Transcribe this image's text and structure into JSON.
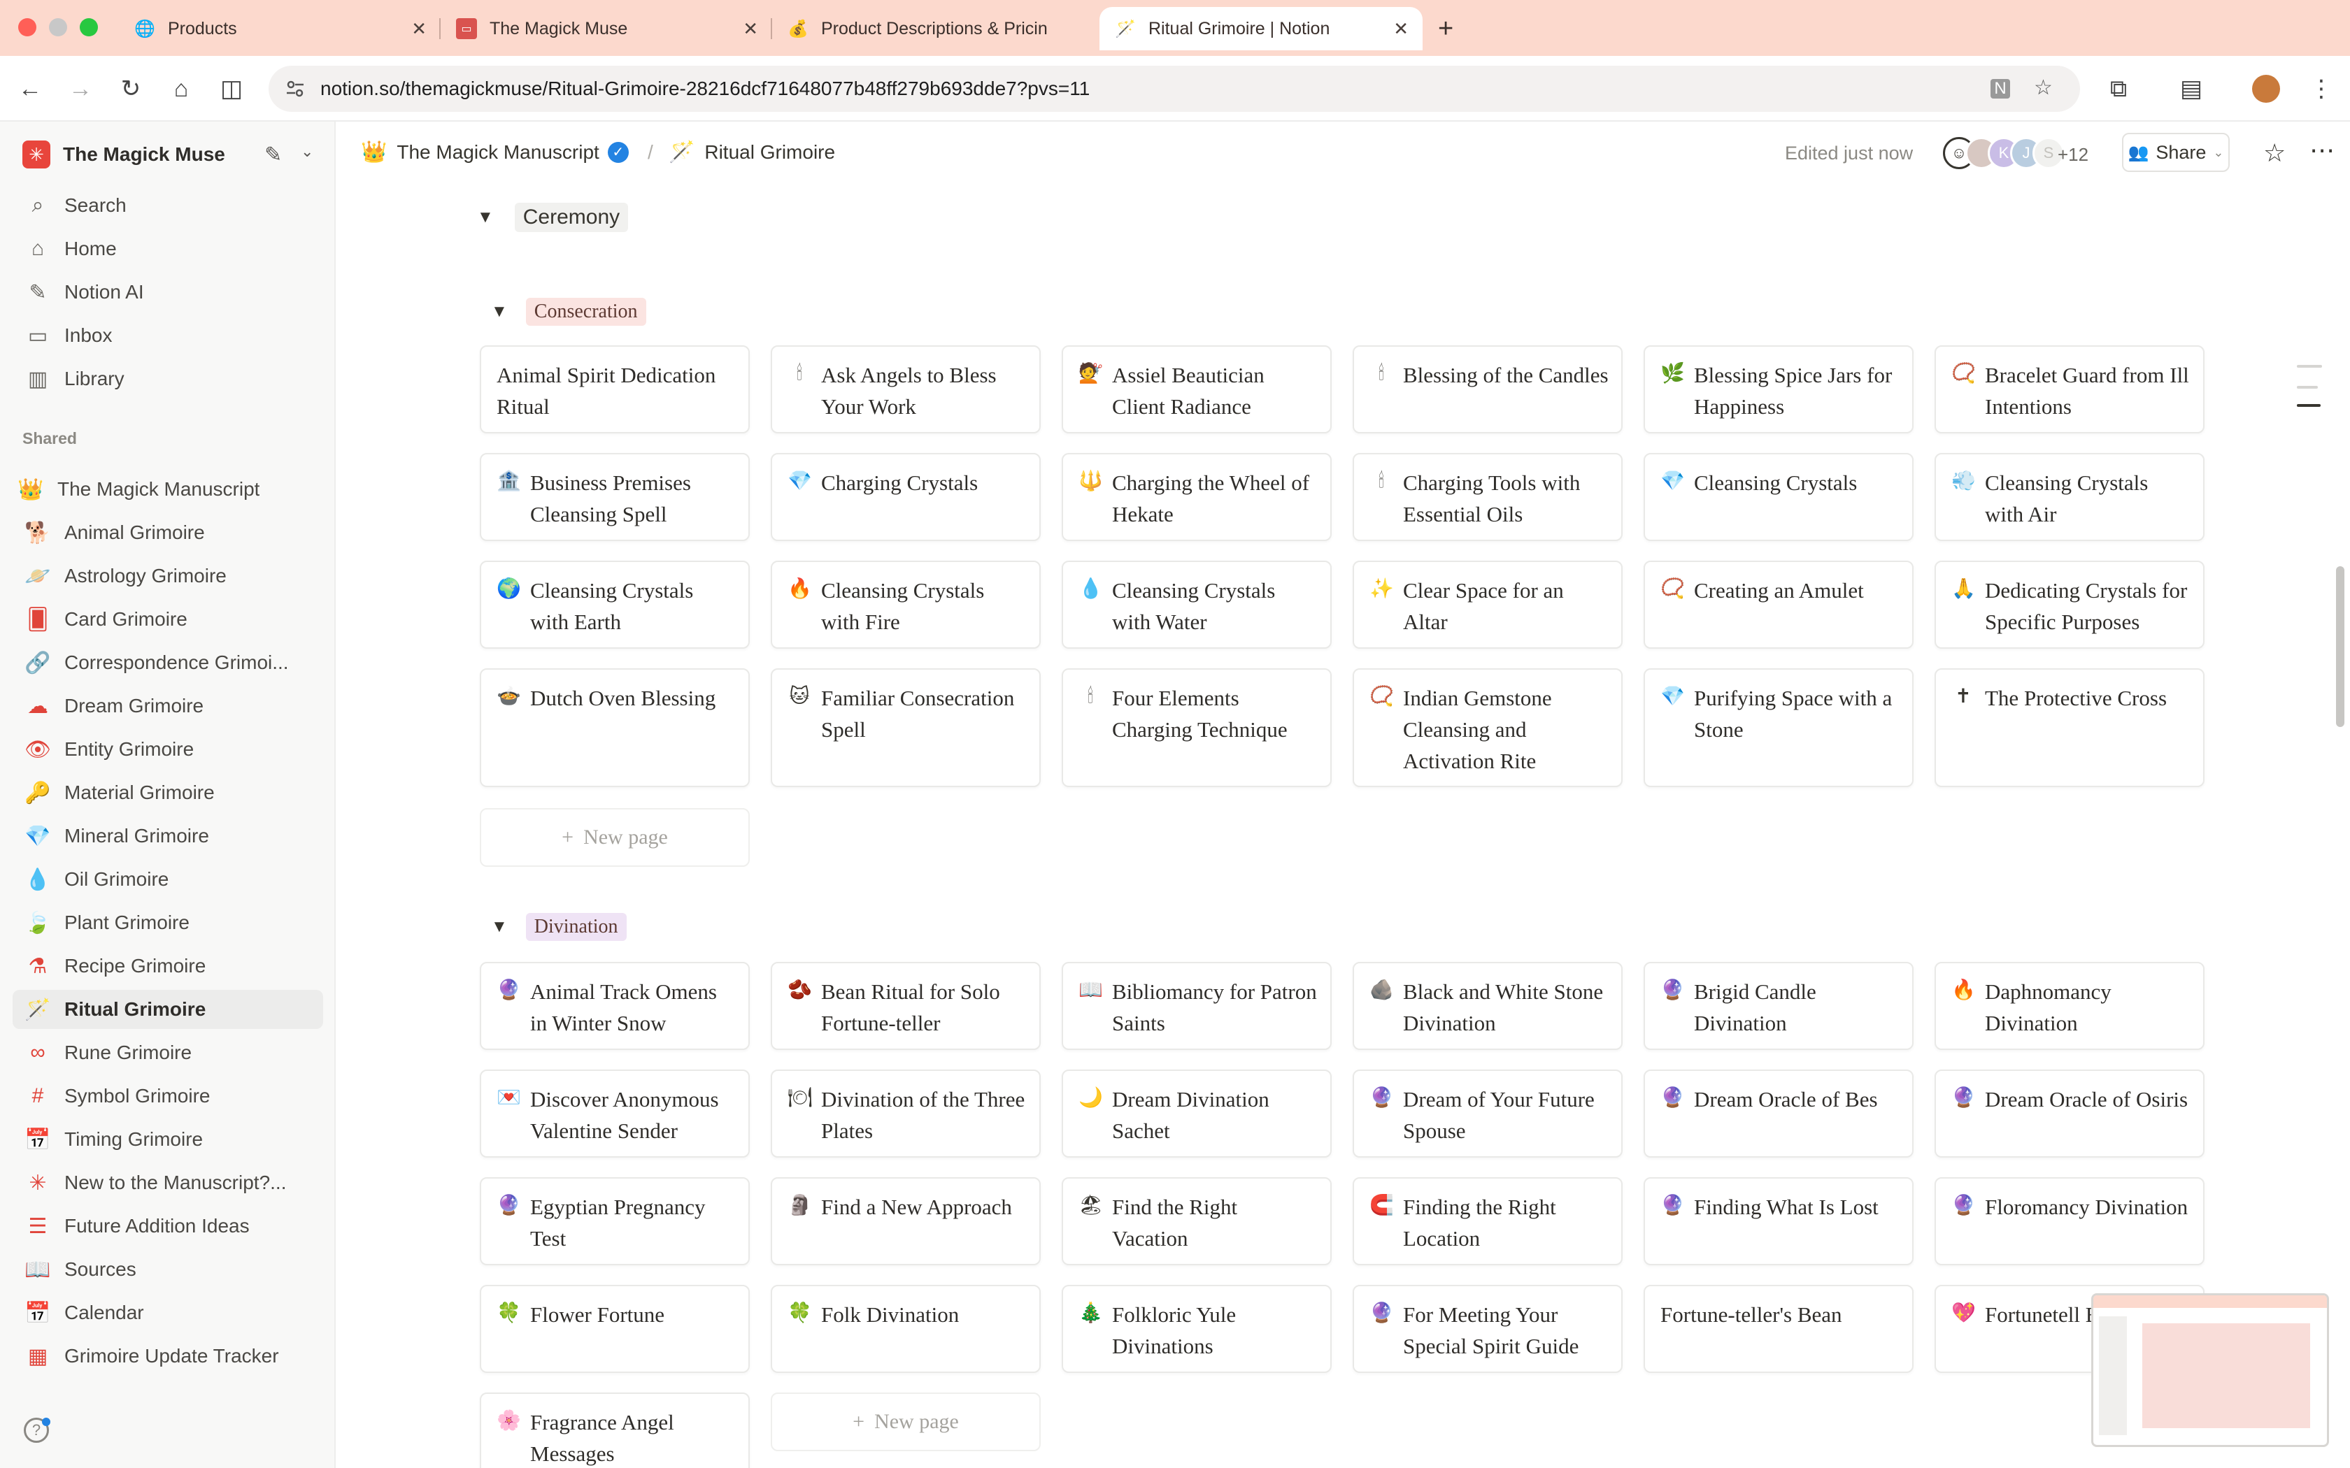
{
  "browser": {
    "tabs": [
      {
        "label": "Products",
        "icon": "globe-icon",
        "glyph": "🌐"
      },
      {
        "label": "The Magick Muse",
        "icon": "shop-icon",
        "glyph": "🟥"
      },
      {
        "label": "Product Descriptions & Pricin",
        "icon": "money-bag-icon",
        "glyph": "💰"
      },
      {
        "label": "Ritual Grimoire | Notion",
        "icon": "magic-wand-icon",
        "glyph": "🪄"
      }
    ],
    "url": "notion.so/themagickmuse/Ritual-Grimoire-28216dcf71648077b48ff279b693dde7?pvs=11",
    "colors": {
      "tabbar": "#fcd9cd",
      "active_tab": "#ffffff"
    }
  },
  "sidebar": {
    "workspace_name": "The Magick Muse",
    "top_items": [
      {
        "label": "Search",
        "icon": "search-icon",
        "glyph": "⌕"
      },
      {
        "label": "Home",
        "icon": "home-icon",
        "glyph": "⌂"
      },
      {
        "label": "Notion AI",
        "icon": "ai-icon",
        "glyph": "✎"
      },
      {
        "label": "Inbox",
        "icon": "inbox-icon",
        "glyph": "▭"
      },
      {
        "label": "Library",
        "icon": "library-icon",
        "glyph": "▥"
      }
    ],
    "shared_heading": "Shared",
    "shared_items": [
      {
        "label": "The Magick Manuscript",
        "icon": "crown-icon",
        "glyph": "👑"
      },
      {
        "label": "Animal Grimoire",
        "icon": "dog-icon",
        "glyph": "🐕"
      },
      {
        "label": "Astrology Grimoire",
        "icon": "planet-icon",
        "glyph": "🪐"
      },
      {
        "label": "Card Grimoire",
        "icon": "cards-icon",
        "glyph": "🂠"
      },
      {
        "label": "Correspondence Grimoi...",
        "icon": "link-icon",
        "glyph": "🔗"
      },
      {
        "label": "Dream Grimoire",
        "icon": "cloud-icon",
        "glyph": "☁"
      },
      {
        "label": "Entity Grimoire",
        "icon": "eye-icon",
        "glyph": "👁"
      },
      {
        "label": "Material Grimoire",
        "icon": "key-icon",
        "glyph": "🔑"
      },
      {
        "label": "Mineral Grimoire",
        "icon": "gem-icon",
        "glyph": "💎"
      },
      {
        "label": "Oil Grimoire",
        "icon": "drop-icon",
        "glyph": "💧"
      },
      {
        "label": "Plant Grimoire",
        "icon": "leaf-icon",
        "glyph": "🍃"
      },
      {
        "label": "Recipe Grimoire",
        "icon": "flask-icon",
        "glyph": "⚗"
      },
      {
        "label": "Ritual Grimoire",
        "icon": "magic-wand-icon",
        "glyph": "🪄"
      },
      {
        "label": "Rune Grimoire",
        "icon": "infinity-icon",
        "glyph": "∞"
      },
      {
        "label": "Symbol Grimoire",
        "icon": "hash-icon",
        "glyph": "#"
      },
      {
        "label": "Timing Grimoire",
        "icon": "calendar-icon",
        "glyph": "📅"
      },
      {
        "label": "New to the Manuscript?...",
        "icon": "sparkle-icon",
        "glyph": "✳"
      },
      {
        "label": "Future Addition Ideas",
        "icon": "list-icon",
        "glyph": "☰"
      },
      {
        "label": "Sources",
        "icon": "book-icon",
        "glyph": "📖"
      },
      {
        "label": "Calendar",
        "icon": "calendar-icon",
        "glyph": "📅"
      },
      {
        "label": "Grimoire Update Tracker",
        "icon": "table-icon",
        "glyph": "▦"
      }
    ],
    "active_item": "Ritual Grimoire"
  },
  "header": {
    "breadcrumb": [
      {
        "label": "The Magick Manuscript",
        "icon": "crown-icon",
        "glyph": "👑"
      },
      {
        "label": "Ritual Grimoire",
        "icon": "magic-wand-icon",
        "glyph": "🪄"
      }
    ],
    "edited": "Edited just now",
    "avatar_letters": [
      "K",
      "J",
      "S"
    ],
    "more_count": "+12",
    "share_label": "Share"
  },
  "content": {
    "section_title": "Ceremony",
    "groups": [
      {
        "label": "Consecration",
        "color": "#fbe4e1",
        "cards": [
          {
            "title": "Animal Spirit Dedication Ritual",
            "glyph": ""
          },
          {
            "title": "Ask Angels to Bless Your Work",
            "glyph": "🕯"
          },
          {
            "title": "Assiel Beautician Client Radiance",
            "glyph": "💇"
          },
          {
            "title": "Blessing of the Candles",
            "glyph": "🕯"
          },
          {
            "title": "Blessing Spice Jars for Happiness",
            "glyph": "🌿"
          },
          {
            "title": "Bracelet Guard from Ill Intentions",
            "glyph": "📿"
          },
          {
            "title": "Business Premises Cleansing Spell",
            "glyph": "🏦"
          },
          {
            "title": "Charging Crystals",
            "glyph": "💎"
          },
          {
            "title": "Charging the Wheel of Hekate",
            "glyph": "🔱"
          },
          {
            "title": "Charging Tools with Essential Oils",
            "glyph": "🕯"
          },
          {
            "title": "Cleansing Crystals",
            "glyph": "💎"
          },
          {
            "title": "Cleansing Crystals with Air",
            "glyph": "💨"
          },
          {
            "title": "Cleansing Crystals with Earth",
            "glyph": "🌍"
          },
          {
            "title": "Cleansing Crystals with Fire",
            "glyph": "🔥"
          },
          {
            "title": "Cleansing Crystals with Water",
            "glyph": "💧"
          },
          {
            "title": "Clear Space for an Altar",
            "glyph": "✨"
          },
          {
            "title": "Creating an Amulet",
            "glyph": "📿"
          },
          {
            "title": "Dedicating Crystals for Specific Purposes",
            "glyph": "🙏"
          },
          {
            "title": "Dutch Oven Blessing",
            "glyph": "🍲"
          },
          {
            "title": "Familiar Consecration Spell",
            "glyph": "🐱"
          },
          {
            "title": "Four Elements Charging Technique",
            "glyph": "🕯"
          },
          {
            "title": "Indian Gemstone Cleansing and Activation Rite",
            "glyph": "📿"
          },
          {
            "title": "Purifying Space with a Stone",
            "glyph": "💎"
          },
          {
            "title": "The Protective Cross",
            "glyph": "✝"
          }
        ],
        "new_page": "New page"
      },
      {
        "label": "Divination",
        "color": "#efe3f5",
        "cards": [
          {
            "title": "Animal Track Omens in Winter Snow",
            "glyph": "🔮"
          },
          {
            "title": "Bean Ritual for Solo Fortune-teller",
            "glyph": "🫘"
          },
          {
            "title": "Bibliomancy for Patron Saints",
            "glyph": "📖"
          },
          {
            "title": "Black and White Stone Divination",
            "glyph": "🪨"
          },
          {
            "title": "Brigid Candle Divination",
            "glyph": "🔮"
          },
          {
            "title": "Daphnomancy Divination",
            "glyph": "🔥"
          },
          {
            "title": "Discover Anonymous Valentine Sender",
            "glyph": "💌"
          },
          {
            "title": "Divination of the Three Plates",
            "glyph": "🍽"
          },
          {
            "title": "Dream Divination Sachet",
            "glyph": "🌙"
          },
          {
            "title": "Dream of Your Future Spouse",
            "glyph": "🔮"
          },
          {
            "title": "Dream Oracle of Bes",
            "glyph": "🔮"
          },
          {
            "title": "Dream Oracle of Osiris",
            "glyph": "🔮"
          },
          {
            "title": "Egyptian Pregnancy Test",
            "glyph": "🔮"
          },
          {
            "title": "Find a New Approach",
            "glyph": "🗿"
          },
          {
            "title": "Find the Right Vacation",
            "glyph": "🏖"
          },
          {
            "title": "Finding the Right Location",
            "glyph": "🧲"
          },
          {
            "title": "Finding What Is Lost",
            "glyph": "🔮"
          },
          {
            "title": "Floromancy Divination",
            "glyph": "🔮"
          },
          {
            "title": "Flower Fortune",
            "glyph": "🍀"
          },
          {
            "title": "Folk Divination",
            "glyph": "🍀"
          },
          {
            "title": "Folkloric Yule Divinations",
            "glyph": "🎄"
          },
          {
            "title": "For Meeting Your Special Spirit Guide",
            "glyph": "🔮"
          },
          {
            "title": "Fortune-teller's Bean",
            "glyph": ""
          },
          {
            "title": "Fortunetell Eggs and B",
            "glyph": "💖"
          },
          {
            "title": "Fragrance Angel Messages",
            "glyph": "🌸"
          }
        ],
        "new_page": "New page"
      }
    ]
  }
}
